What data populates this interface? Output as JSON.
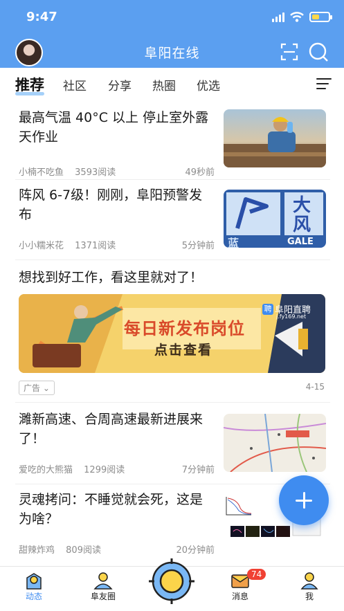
{
  "status_bar": {
    "time": "9:47"
  },
  "header": {
    "title": "阜阳在线"
  },
  "tabs": [
    {
      "label": "推荐",
      "active": true
    },
    {
      "label": "社区"
    },
    {
      "label": "分享"
    },
    {
      "label": "热圈"
    },
    {
      "label": "优选"
    }
  ],
  "feed": [
    {
      "headline": "最高气温 40°C 以上 停止室外露天作业",
      "author": "小楠不吃鱼",
      "reads": "3593阅读",
      "time": "49秒前",
      "thumb_icon": "worker-photo"
    },
    {
      "headline": "阵风 6-7级！刚刚，阜阳预警发布",
      "author": "小小糯米花",
      "reads": "1371阅读",
      "time": "5分钟前",
      "thumb_icon": "gale-warning-sign"
    }
  ],
  "ad": {
    "headline": "想找到好工作，看这里就对了！",
    "banner_brand": "阜阳直聘",
    "banner_brand_icon_text": "聘",
    "banner_url": "j.fy169.net",
    "banner_title": "每日新发布岗位",
    "banner_cta": "点击查看",
    "tag": "广告",
    "date": "4-15"
  },
  "feed2": [
    {
      "headline": "濉新高速、合周高速最新进展来了！",
      "author": "爱吃的大熊猫",
      "reads": "1299阅读",
      "time": "7分钟前",
      "thumb_icon": "road-map"
    },
    {
      "headline": "灵魂拷问：不睡觉就会死，这是为啥？",
      "author": "甜辣炸鸡",
      "reads": "809阅读",
      "time": "20分钟前",
      "thumb_icon": "science-figure"
    }
  ],
  "thumb_text": {
    "gale_big": "大",
    "gale_wind": "风",
    "gale_word": "GALE",
    "gale_blue": "蓝"
  },
  "tabbar": [
    {
      "label": "动态",
      "active": true,
      "icon": "map-pin-icon"
    },
    {
      "label": "阜友圈",
      "icon": "friends-icon"
    },
    {
      "label": "",
      "icon": "center-compass-icon"
    },
    {
      "label": "消息",
      "icon": "message-icon",
      "badge": "74"
    },
    {
      "label": "我",
      "icon": "profile-icon"
    }
  ],
  "colors": {
    "header_bg": "#5b9ff0",
    "accent": "#3f8cf0",
    "badge": "#f04134"
  }
}
